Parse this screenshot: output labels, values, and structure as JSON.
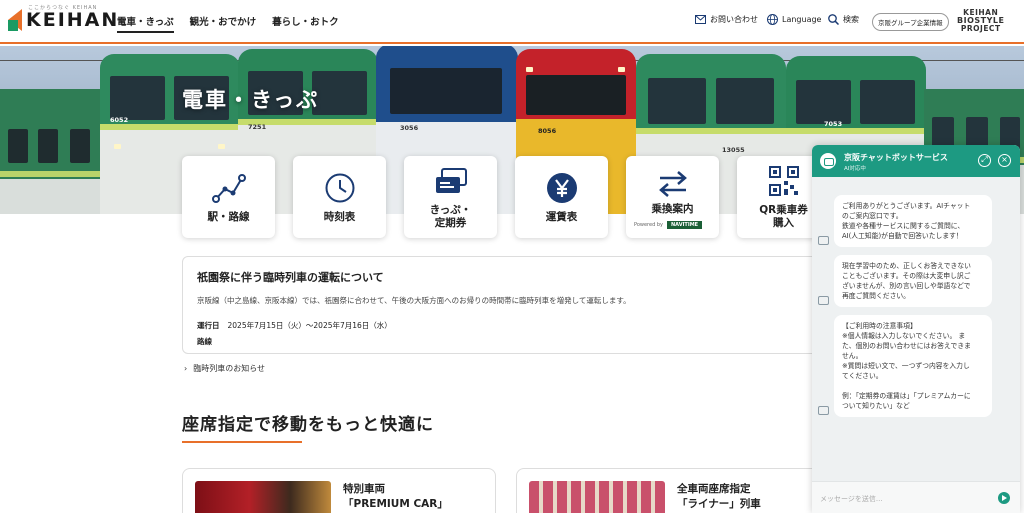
{
  "header": {
    "logo_text": "KEIHAN",
    "logo_sub": "ここからつなぐ KEIHAN",
    "nav": [
      "電車・きっぷ",
      "観光・おでかけ",
      "暮らし・おトク"
    ],
    "contact_label": "お問い合わせ",
    "language_label": "Language",
    "search_label": "検索",
    "group_label": "京阪グループ企業情報",
    "bio_line1": "KEIHAN",
    "bio_line2": "BIOSTYLE",
    "bio_line3": "PROJECT"
  },
  "hero": {
    "title": "電車・きっぷ",
    "train_numbers": [
      "6052",
      "7251",
      "3056",
      "8056",
      "13055",
      "7053"
    ]
  },
  "quick_menu": [
    {
      "label": "駅・路線",
      "icon": "route-icon"
    },
    {
      "label": "時刻表",
      "icon": "clock-icon"
    },
    {
      "label": "きっぷ・\n定期券",
      "icon": "ticket-icon"
    },
    {
      "label": "運賃表",
      "icon": "yen-icon"
    },
    {
      "label": "乗換案内",
      "icon": "transfer-icon",
      "powered": "Powered by",
      "powered_brand": "NAVITIME"
    },
    {
      "label": "QR乗車券\n購入",
      "icon": "qr-icon"
    }
  ],
  "notice": {
    "title": "祇園祭に伴う臨時列車の運転について",
    "body": "京阪線（中之島線、京阪本線）では、祇園祭に合わせて、午後の大阪方面へのお帰りの時間帯に臨時列車を増発して運転します。",
    "date_label": "運行日",
    "date_value": "2025年7月15日（火）～2025年7月16日（水）",
    "route_label": "路線"
  },
  "more_link": "臨時列車のお知らせ",
  "section": {
    "title": "座席指定で移動をもっと快適に"
  },
  "cards": [
    {
      "title": "特別車両\n「PREMIUM CAR」"
    },
    {
      "title": "全車両座席指定\n「ライナー」列車"
    }
  ],
  "chat": {
    "title": "京阪チャットボットサービス",
    "subtitle": "AI対応中",
    "messages": [
      [
        "ご利用ありがとうございます。AIチャット",
        "のご案内窓口です。",
        "鉄道や各種サービスに関するご質問に、",
        "AI(人工知能)が自動で回答いたします！"
      ],
      [
        "現在学習中のため、正しくお答えできない",
        "こともございます。その際は大変申し訳ご",
        "ざいませんが、別の言い回しや単語などで",
        "再度ご質問ください。"
      ],
      [
        "【ご利用時の注意事項】",
        "※個人情報は入力しないでください。 ま",
        "た、個別のお問い合わせにはお答えできま",
        "せん。",
        "※質問は短い文で、一つずつ内容を入力し",
        "てください。",
        "",
        "例：「定期券の運賃は」「プレミアムカーに",
        "ついて知りたい」など"
      ]
    ],
    "input_placeholder": "メッセージを送信..."
  },
  "colors": {
    "accent": "#e8702a",
    "brand_green": "#1a9a63",
    "chat_green": "#1d9a82"
  }
}
